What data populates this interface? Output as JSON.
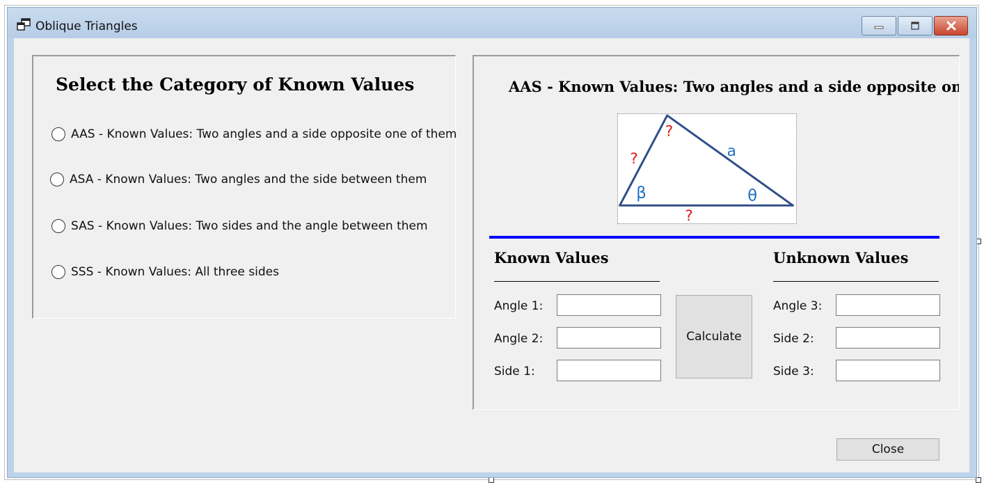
{
  "window": {
    "title": "Oblique Triangles",
    "buttons": {
      "minimize_icon": "minimize-icon",
      "maximize_icon": "maximize-icon",
      "close_icon": "close-icon"
    }
  },
  "category_group": {
    "heading": "Select the Category of Known Values",
    "options": [
      {
        "id": "aas",
        "label": "AAS - Known Values: Two angles and a side opposite one of them",
        "selected": false
      },
      {
        "id": "asa",
        "label": "ASA - Known Values: Two angles and the side between them",
        "selected": false
      },
      {
        "id": "sas",
        "label": "SAS - Known Values: Two sides and the angle between them",
        "selected": false
      },
      {
        "id": "sss",
        "label": "SSS - Known Values: All three sides",
        "selected": false
      }
    ]
  },
  "solver_group": {
    "heading": "AAS - Known Values: Two angles and a side opposite one of them",
    "diagram": {
      "labels": {
        "top_angle": "?",
        "left_side": "?",
        "right_side": "a",
        "left_angle": "β",
        "right_angle": "θ",
        "bottom_side": "?"
      },
      "colors": {
        "edge": "#2e4d87",
        "known": "#1f72c4",
        "unknown": "#e01b1b"
      }
    },
    "known": {
      "heading": "Known Values",
      "fields": [
        {
          "label": "Angle 1:",
          "value": ""
        },
        {
          "label": "Angle 2:",
          "value": ""
        },
        {
          "label": "Side 1:",
          "value": ""
        }
      ]
    },
    "unknown": {
      "heading": "Unknown Values",
      "fields": [
        {
          "label": "Angle 3:",
          "value": ""
        },
        {
          "label": "Side 2:",
          "value": ""
        },
        {
          "label": "Side 3:",
          "value": ""
        }
      ]
    },
    "calculate_label": "Calculate"
  },
  "close_label": "Close",
  "colors": {
    "rule": "#0000ff"
  }
}
